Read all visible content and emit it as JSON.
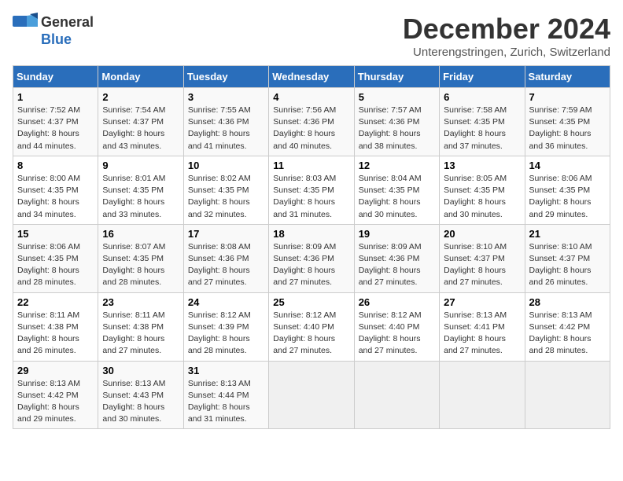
{
  "header": {
    "logo_general": "General",
    "logo_blue": "Blue",
    "month_title": "December 2024",
    "subtitle": "Unterengstringen, Zurich, Switzerland"
  },
  "days_of_week": [
    "Sunday",
    "Monday",
    "Tuesday",
    "Wednesday",
    "Thursday",
    "Friday",
    "Saturday"
  ],
  "weeks": [
    [
      {
        "day": 1,
        "sunrise": "Sunrise: 7:52 AM",
        "sunset": "Sunset: 4:37 PM",
        "daylight": "Daylight: 8 hours and 44 minutes."
      },
      {
        "day": 2,
        "sunrise": "Sunrise: 7:54 AM",
        "sunset": "Sunset: 4:37 PM",
        "daylight": "Daylight: 8 hours and 43 minutes."
      },
      {
        "day": 3,
        "sunrise": "Sunrise: 7:55 AM",
        "sunset": "Sunset: 4:36 PM",
        "daylight": "Daylight: 8 hours and 41 minutes."
      },
      {
        "day": 4,
        "sunrise": "Sunrise: 7:56 AM",
        "sunset": "Sunset: 4:36 PM",
        "daylight": "Daylight: 8 hours and 40 minutes."
      },
      {
        "day": 5,
        "sunrise": "Sunrise: 7:57 AM",
        "sunset": "Sunset: 4:36 PM",
        "daylight": "Daylight: 8 hours and 38 minutes."
      },
      {
        "day": 6,
        "sunrise": "Sunrise: 7:58 AM",
        "sunset": "Sunset: 4:35 PM",
        "daylight": "Daylight: 8 hours and 37 minutes."
      },
      {
        "day": 7,
        "sunrise": "Sunrise: 7:59 AM",
        "sunset": "Sunset: 4:35 PM",
        "daylight": "Daylight: 8 hours and 36 minutes."
      }
    ],
    [
      {
        "day": 8,
        "sunrise": "Sunrise: 8:00 AM",
        "sunset": "Sunset: 4:35 PM",
        "daylight": "Daylight: 8 hours and 34 minutes."
      },
      {
        "day": 9,
        "sunrise": "Sunrise: 8:01 AM",
        "sunset": "Sunset: 4:35 PM",
        "daylight": "Daylight: 8 hours and 33 minutes."
      },
      {
        "day": 10,
        "sunrise": "Sunrise: 8:02 AM",
        "sunset": "Sunset: 4:35 PM",
        "daylight": "Daylight: 8 hours and 32 minutes."
      },
      {
        "day": 11,
        "sunrise": "Sunrise: 8:03 AM",
        "sunset": "Sunset: 4:35 PM",
        "daylight": "Daylight: 8 hours and 31 minutes."
      },
      {
        "day": 12,
        "sunrise": "Sunrise: 8:04 AM",
        "sunset": "Sunset: 4:35 PM",
        "daylight": "Daylight: 8 hours and 30 minutes."
      },
      {
        "day": 13,
        "sunrise": "Sunrise: 8:05 AM",
        "sunset": "Sunset: 4:35 PM",
        "daylight": "Daylight: 8 hours and 30 minutes."
      },
      {
        "day": 14,
        "sunrise": "Sunrise: 8:06 AM",
        "sunset": "Sunset: 4:35 PM",
        "daylight": "Daylight: 8 hours and 29 minutes."
      }
    ],
    [
      {
        "day": 15,
        "sunrise": "Sunrise: 8:06 AM",
        "sunset": "Sunset: 4:35 PM",
        "daylight": "Daylight: 8 hours and 28 minutes."
      },
      {
        "day": 16,
        "sunrise": "Sunrise: 8:07 AM",
        "sunset": "Sunset: 4:35 PM",
        "daylight": "Daylight: 8 hours and 28 minutes."
      },
      {
        "day": 17,
        "sunrise": "Sunrise: 8:08 AM",
        "sunset": "Sunset: 4:36 PM",
        "daylight": "Daylight: 8 hours and 27 minutes."
      },
      {
        "day": 18,
        "sunrise": "Sunrise: 8:09 AM",
        "sunset": "Sunset: 4:36 PM",
        "daylight": "Daylight: 8 hours and 27 minutes."
      },
      {
        "day": 19,
        "sunrise": "Sunrise: 8:09 AM",
        "sunset": "Sunset: 4:36 PM",
        "daylight": "Daylight: 8 hours and 27 minutes."
      },
      {
        "day": 20,
        "sunrise": "Sunrise: 8:10 AM",
        "sunset": "Sunset: 4:37 PM",
        "daylight": "Daylight: 8 hours and 27 minutes."
      },
      {
        "day": 21,
        "sunrise": "Sunrise: 8:10 AM",
        "sunset": "Sunset: 4:37 PM",
        "daylight": "Daylight: 8 hours and 26 minutes."
      }
    ],
    [
      {
        "day": 22,
        "sunrise": "Sunrise: 8:11 AM",
        "sunset": "Sunset: 4:38 PM",
        "daylight": "Daylight: 8 hours and 26 minutes."
      },
      {
        "day": 23,
        "sunrise": "Sunrise: 8:11 AM",
        "sunset": "Sunset: 4:38 PM",
        "daylight": "Daylight: 8 hours and 27 minutes."
      },
      {
        "day": 24,
        "sunrise": "Sunrise: 8:12 AM",
        "sunset": "Sunset: 4:39 PM",
        "daylight": "Daylight: 8 hours and 28 minutes."
      },
      {
        "day": 25,
        "sunrise": "Sunrise: 8:12 AM",
        "sunset": "Sunset: 4:40 PM",
        "daylight": "Daylight: 8 hours and 27 minutes."
      },
      {
        "day": 26,
        "sunrise": "Sunrise: 8:12 AM",
        "sunset": "Sunset: 4:40 PM",
        "daylight": "Daylight: 8 hours and 27 minutes."
      },
      {
        "day": 27,
        "sunrise": "Sunrise: 8:13 AM",
        "sunset": "Sunset: 4:41 PM",
        "daylight": "Daylight: 8 hours and 27 minutes."
      },
      {
        "day": 28,
        "sunrise": "Sunrise: 8:13 AM",
        "sunset": "Sunset: 4:42 PM",
        "daylight": "Daylight: 8 hours and 28 minutes."
      }
    ],
    [
      {
        "day": 29,
        "sunrise": "Sunrise: 8:13 AM",
        "sunset": "Sunset: 4:42 PM",
        "daylight": "Daylight: 8 hours and 29 minutes."
      },
      {
        "day": 30,
        "sunrise": "Sunrise: 8:13 AM",
        "sunset": "Sunset: 4:43 PM",
        "daylight": "Daylight: 8 hours and 30 minutes."
      },
      {
        "day": 31,
        "sunrise": "Sunrise: 8:13 AM",
        "sunset": "Sunset: 4:44 PM",
        "daylight": "Daylight: 8 hours and 31 minutes."
      },
      null,
      null,
      null,
      null
    ]
  ]
}
